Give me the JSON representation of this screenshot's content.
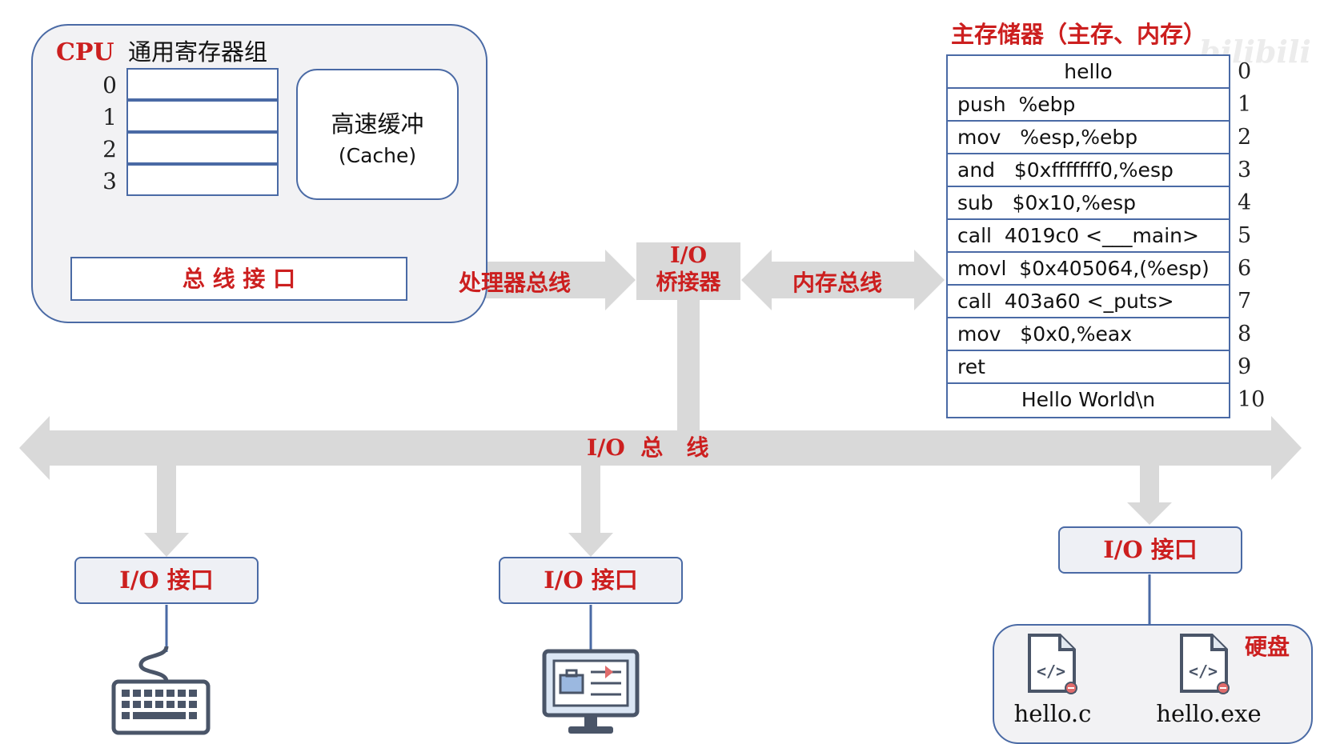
{
  "cpu": {
    "label": "CPU",
    "register_group_label": "通用寄存器组",
    "register_indices": [
      "0",
      "1",
      "2",
      "3"
    ],
    "cache_label": "高速缓冲",
    "cache_sublabel": "(Cache)",
    "bus_interface_label": "总 线 接 口"
  },
  "buses": {
    "processor_bus": "处理器总线",
    "io_bridge_line1": "I/O",
    "io_bridge_line2": "桥接器",
    "memory_bus": "内存总线",
    "io_bus": "I/O  总   线"
  },
  "memory": {
    "title": "主存储器（主存、内存）",
    "rows": [
      {
        "text": "hello",
        "index": "0",
        "centered": true
      },
      {
        "text": "push  %ebp",
        "index": "1"
      },
      {
        "text": "mov   %esp,%ebp",
        "index": "2"
      },
      {
        "text": "and   $0xfffffff0,%esp",
        "index": "3"
      },
      {
        "text": "sub   $0x10,%esp",
        "index": "4"
      },
      {
        "text": "call  4019c0 <___main>",
        "index": "5"
      },
      {
        "text": "movl  $0x405064,(%esp)",
        "index": "6"
      },
      {
        "text": "call  403a60 <_puts>",
        "index": "7"
      },
      {
        "text": "mov   $0x0,%eax",
        "index": "8"
      },
      {
        "text": "ret",
        "index": "9"
      },
      {
        "text": "Hello World\\n",
        "index": "10",
        "centered": true
      }
    ]
  },
  "io_interfaces": {
    "keyboard": "I/O 接口",
    "display": "I/O 接口",
    "disk": "I/O 接口"
  },
  "disk": {
    "label": "硬盘",
    "files": [
      "hello.c",
      "hello.exe"
    ]
  },
  "watermark": "bilibili",
  "colors": {
    "accent_red": "#cc1f1f",
    "border_blue": "#4a6aa5",
    "bus_gray": "#d9d9d9"
  }
}
